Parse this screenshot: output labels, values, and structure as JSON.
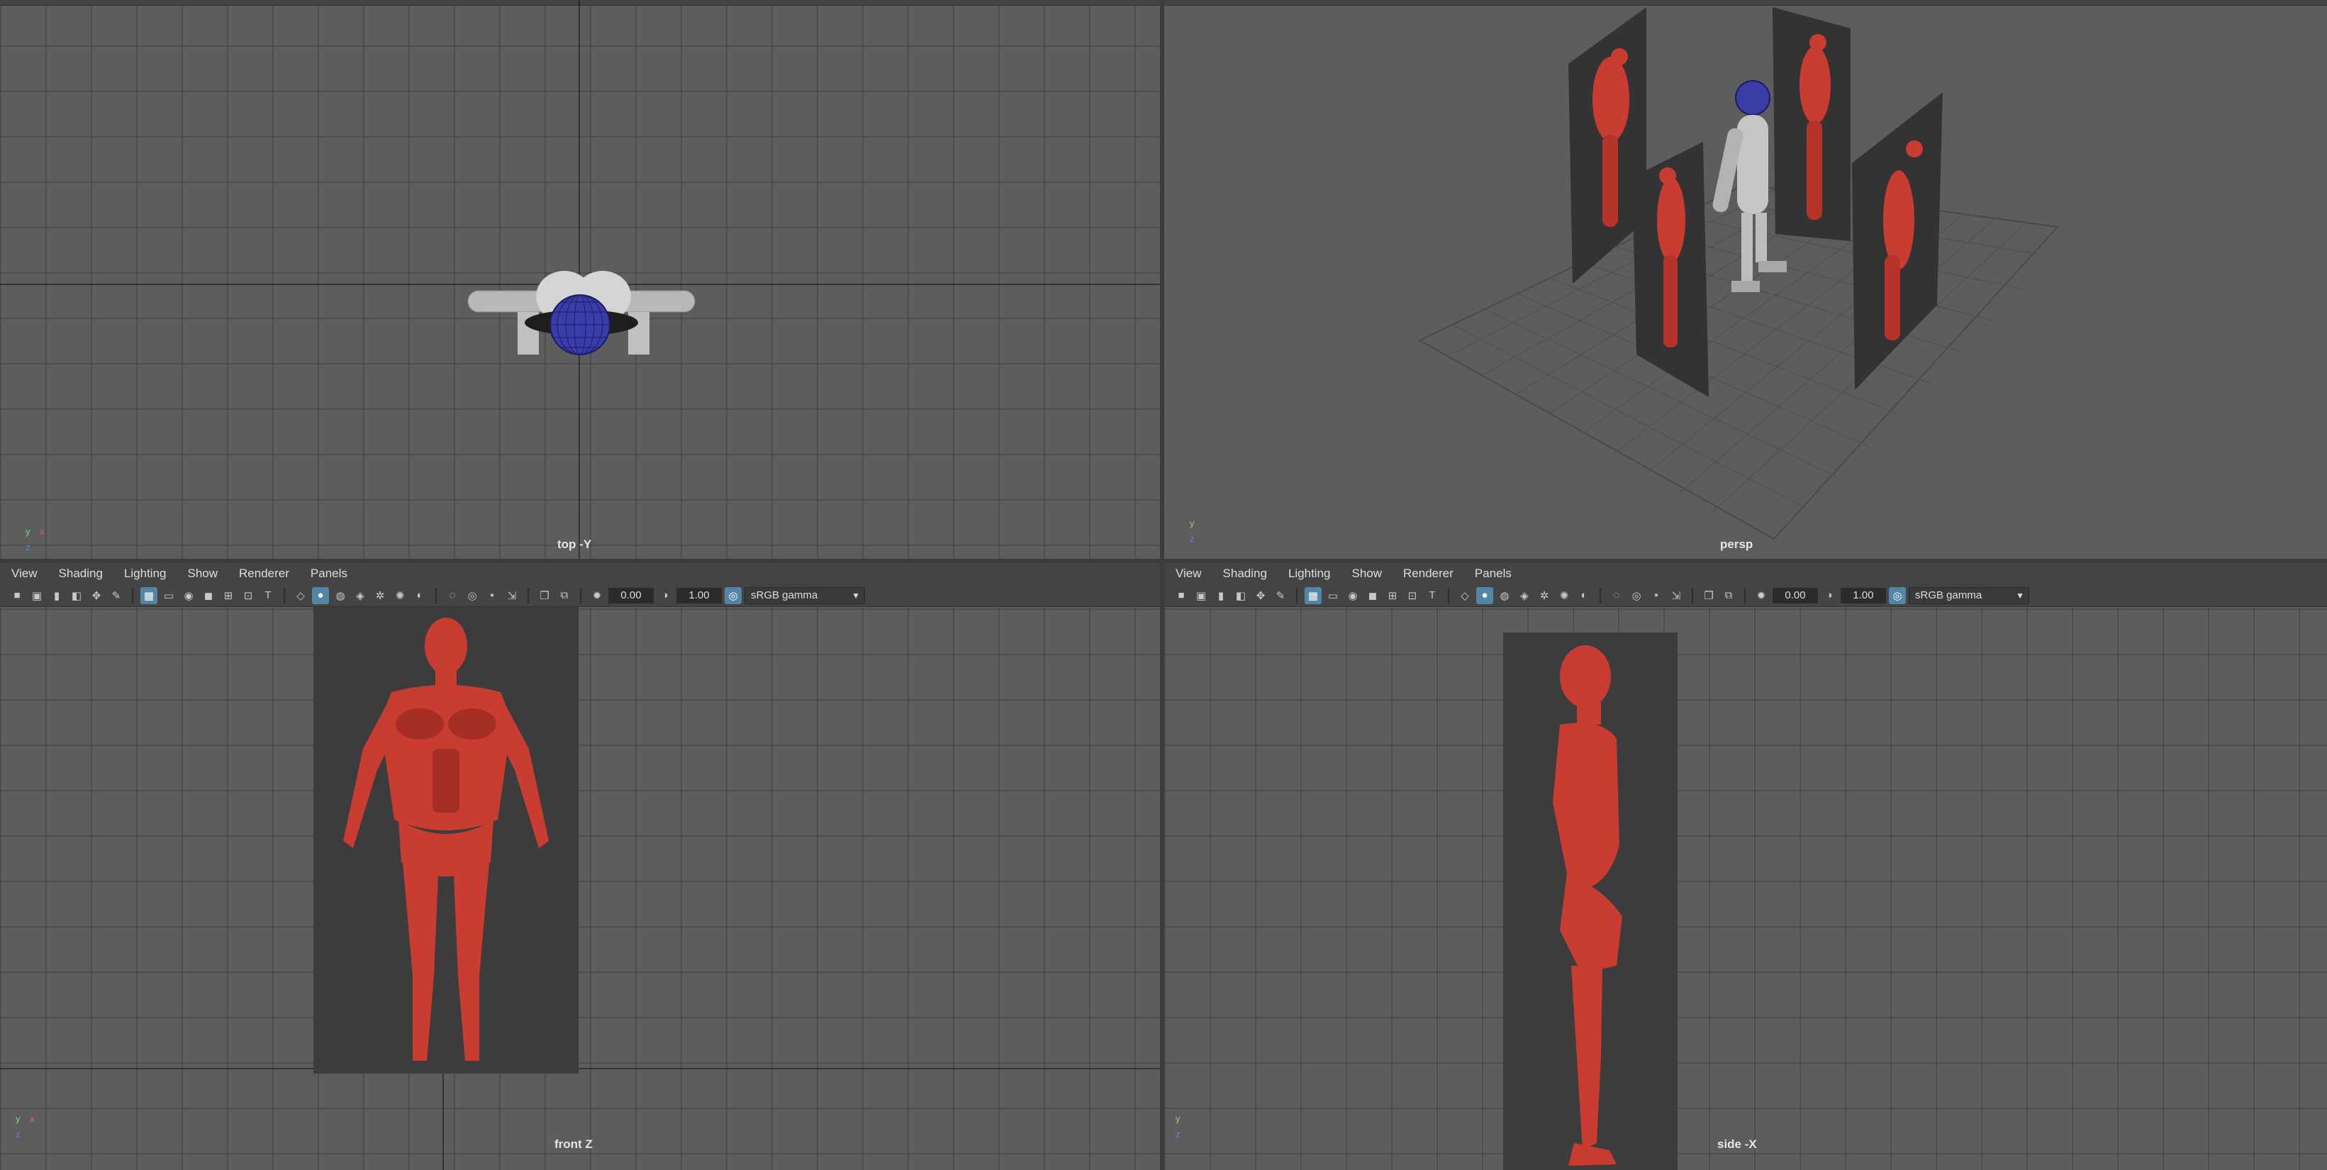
{
  "menus": {
    "bottom_left": [
      "View",
      "Shading",
      "Lighting",
      "Show",
      "Renderer",
      "Panels"
    ],
    "bottom_right": [
      "View",
      "Shading",
      "Lighting",
      "Show",
      "Renderer",
      "Panels"
    ]
  },
  "toolbar": {
    "exposure_value": "0.00",
    "gamma_value": "1.00",
    "color_space": "sRGB gamma"
  },
  "viewports": {
    "top": {
      "label": "top -Y"
    },
    "persp": {
      "label": "persp"
    },
    "front": {
      "label": "front Z"
    },
    "side": {
      "label": "side -X"
    }
  },
  "axes": {
    "y": "y",
    "x": "x",
    "z": "z"
  },
  "icons": [
    "camera-icon",
    "grid-icon",
    "wireframe-icon",
    "smooth-shade-icon",
    "textured-icon",
    "light-icon",
    "shadow-icon",
    "exposure-icon",
    "gamma-icon",
    "color-management-icon"
  ],
  "colors": {
    "viewport_bg": "#5d5d5d",
    "accent": "#5285a6",
    "model_red": "#c83c32",
    "image_plane": "#3c3c3c"
  }
}
